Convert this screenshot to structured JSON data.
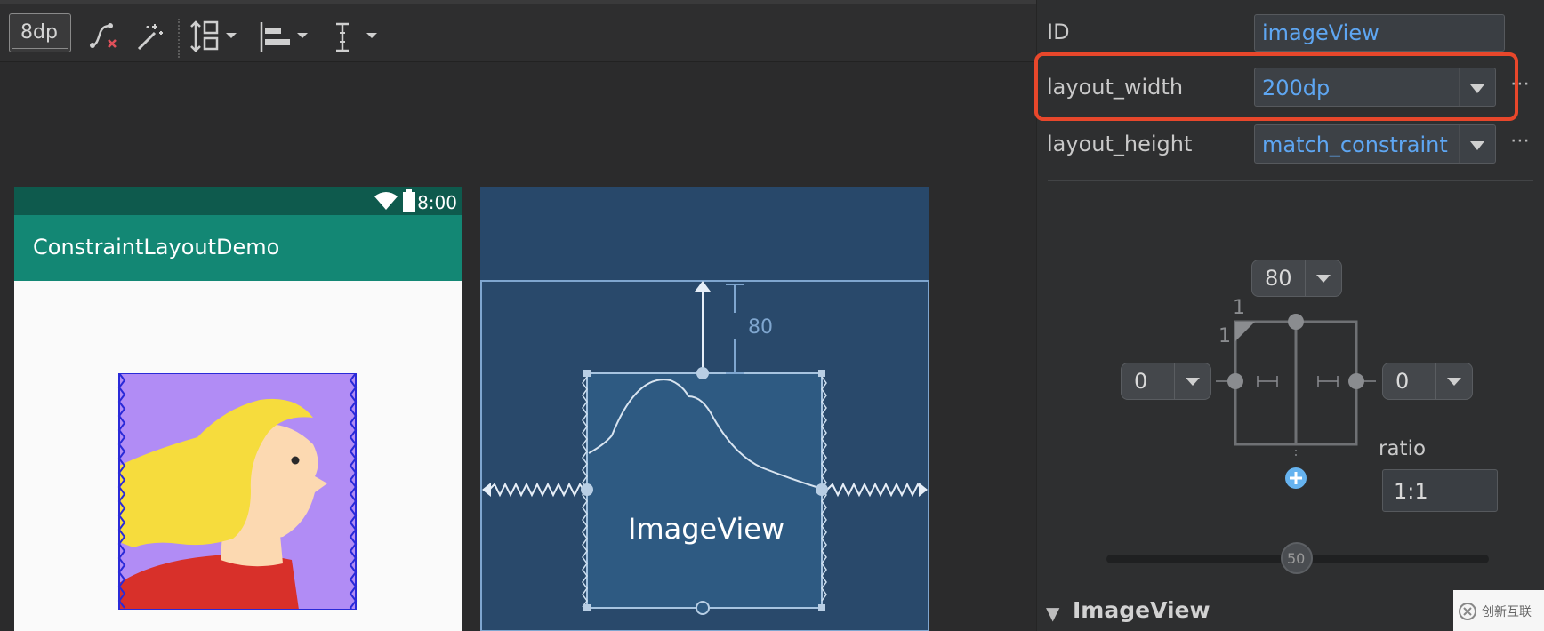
{
  "toolbar": {
    "margin_value": "8dp",
    "icons": [
      "clear-constraints-icon",
      "infer-constraints-icon",
      "pack-icon",
      "align-icon",
      "guidelines-icon"
    ]
  },
  "preview": {
    "status_time": "8:00",
    "app_title": "ConstraintLayoutDemo"
  },
  "blueprint": {
    "top_margin": "80",
    "widget_label": "ImageView"
  },
  "attributes": {
    "id_label": "ID",
    "id_value": "imageView",
    "layout_width_label": "layout_width",
    "layout_width_value": "200dp",
    "layout_height_label": "layout_height",
    "layout_height_value": "match_constraint",
    "more_glyph": "⋯"
  },
  "constraint_widget": {
    "top_margin": "80",
    "left_margin": "0",
    "right_margin": "0",
    "ratio_w": "1",
    "ratio_h": "1",
    "ratio_label": "ratio",
    "ratio_value": "1:1",
    "bias": "50"
  },
  "section": {
    "title": "ImageView",
    "collapse_glyph": "▼"
  },
  "watermark": {
    "text": "创新互联"
  },
  "colors": {
    "highlight": "#e8472b",
    "accent_blue": "#5ea6f2",
    "primary_dark": "#0e5a4d",
    "primary": "#138774"
  }
}
